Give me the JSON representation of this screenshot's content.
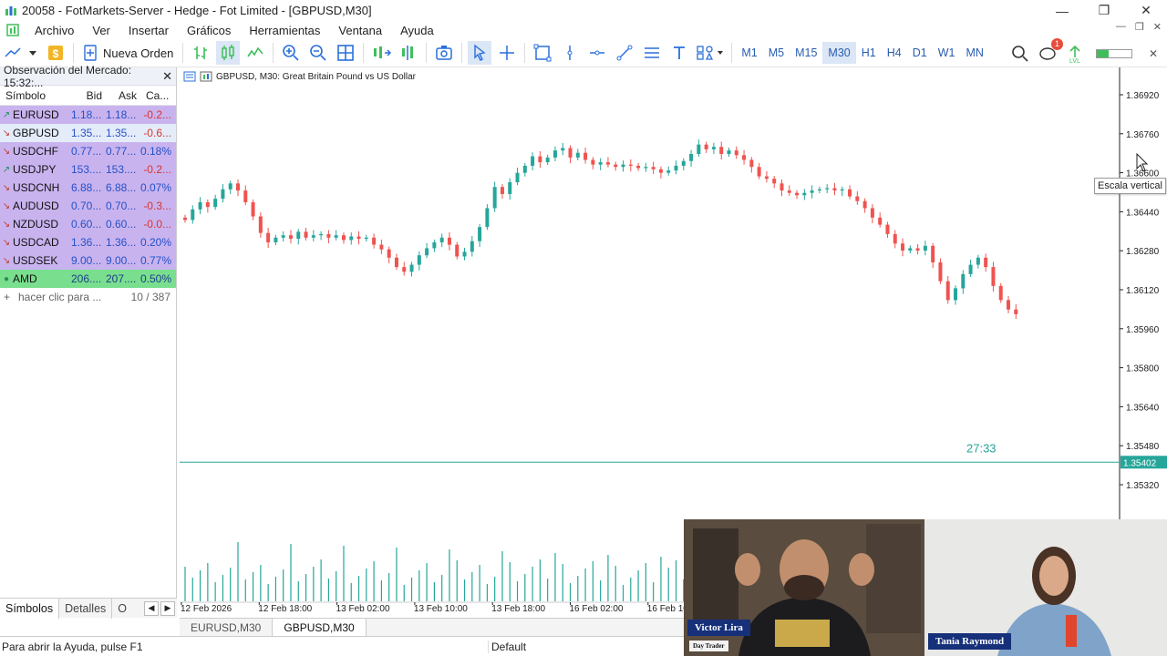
{
  "window": {
    "title": "20058 - FotMarkets-Server - Hedge - Fot Limited - [GBPUSD,M30]"
  },
  "menu": [
    "Archivo",
    "Ver",
    "Insertar",
    "Gráficos",
    "Herramientas",
    "Ventana",
    "Ayuda"
  ],
  "toolbar": {
    "new_order": "Nueva Orden",
    "timeframes": [
      "M1",
      "M5",
      "M15",
      "M30",
      "H1",
      "H4",
      "D1",
      "W1",
      "MN"
    ],
    "active_timeframe": "M30",
    "notifications": "1",
    "connection_level": 0.35
  },
  "market_watch": {
    "title": "Observación del Mercado: 15:32:...",
    "columns": {
      "symbol": "Símbolo",
      "bid": "Bid",
      "ask": "Ask",
      "change": "Ca..."
    },
    "rows": [
      {
        "symbol": "EURUSD",
        "bid": "1.18...",
        "ask": "1.18...",
        "change": "-0.2...",
        "dir": "up",
        "bg": "#c9b3ef",
        "change_color": "#d9342b"
      },
      {
        "symbol": "GBPUSD",
        "bid": "1.35...",
        "ask": "1.35...",
        "change": "-0.6...",
        "dir": "down",
        "bg": "#e4ecfa",
        "change_color": "#d9342b"
      },
      {
        "symbol": "USDCHF",
        "bid": "0.77...",
        "ask": "0.77...",
        "change": "0.18%",
        "dir": "down",
        "bg": "#c9b3ef",
        "change_color": "#2451c6"
      },
      {
        "symbol": "USDJPY",
        "bid": "153....",
        "ask": "153....",
        "change": "-0.2...",
        "dir": "up",
        "bg": "#c9b3ef",
        "change_color": "#d9342b"
      },
      {
        "symbol": "USDCNH",
        "bid": "6.88...",
        "ask": "6.88...",
        "change": "0.07%",
        "dir": "down",
        "bg": "#c9b3ef",
        "change_color": "#2451c6"
      },
      {
        "symbol": "AUDUSD",
        "bid": "0.70...",
        "ask": "0.70...",
        "change": "-0.3...",
        "dir": "down",
        "bg": "#c9b3ef",
        "change_color": "#d9342b"
      },
      {
        "symbol": "NZDUSD",
        "bid": "0.60...",
        "ask": "0.60...",
        "change": "-0.0...",
        "dir": "down",
        "bg": "#c9b3ef",
        "change_color": "#d9342b"
      },
      {
        "symbol": "USDCAD",
        "bid": "1.36...",
        "ask": "1.36...",
        "change": "0.20%",
        "dir": "down",
        "bg": "#c9b3ef",
        "change_color": "#2451c6"
      },
      {
        "symbol": "USDSEK",
        "bid": "9.00...",
        "ask": "9.00...",
        "change": "0.77%",
        "dir": "down",
        "bg": "#c9b3ef",
        "change_color": "#2451c6"
      },
      {
        "symbol": "AMD",
        "bid": "206....",
        "ask": "207....",
        "change": "0.50%",
        "dir": "flat",
        "bg": "#79df8e",
        "change_color": "#1e3c8c"
      }
    ],
    "add_label": "hacer clic para ...",
    "count": "10 / 387",
    "tabs": [
      "Símbolos",
      "Detalles",
      "O"
    ]
  },
  "chart": {
    "header": "GBPUSD, M30:  Great Britain Pound vs US Dollar",
    "timer": "27:33",
    "current_price": "1.35402",
    "tooltip": "Escala vertical",
    "price_ticks": [
      "1.36920",
      "1.36760",
      "1.36600",
      "1.36440",
      "1.36280",
      "1.36120",
      "1.35960",
      "1.35800",
      "1.35640",
      "1.35480",
      "1.35320"
    ],
    "time_ticks": [
      "12 Feb 2026",
      "12 Feb 18:00",
      "13 Feb 02:00",
      "13 Feb 10:00",
      "13 Feb 18:00",
      "16 Feb 02:00",
      "16 Feb 10"
    ],
    "colors": {
      "bull": "#26a69a",
      "bear": "#ef5350",
      "price_line": "#26a69a",
      "volume": "#26a69a"
    }
  },
  "chart_tabs": [
    "EURUSD,M30",
    "GBPUSD,M30"
  ],
  "active_chart_tab": "GBPUSD,M30",
  "status": {
    "help": "Para abrir la Ayuda, pulse F1",
    "profile": "Default"
  },
  "webcams": {
    "left": {
      "name": "Victor Lira",
      "role": "Day Trader"
    },
    "right": {
      "name": "Tania Raymond"
    }
  }
}
